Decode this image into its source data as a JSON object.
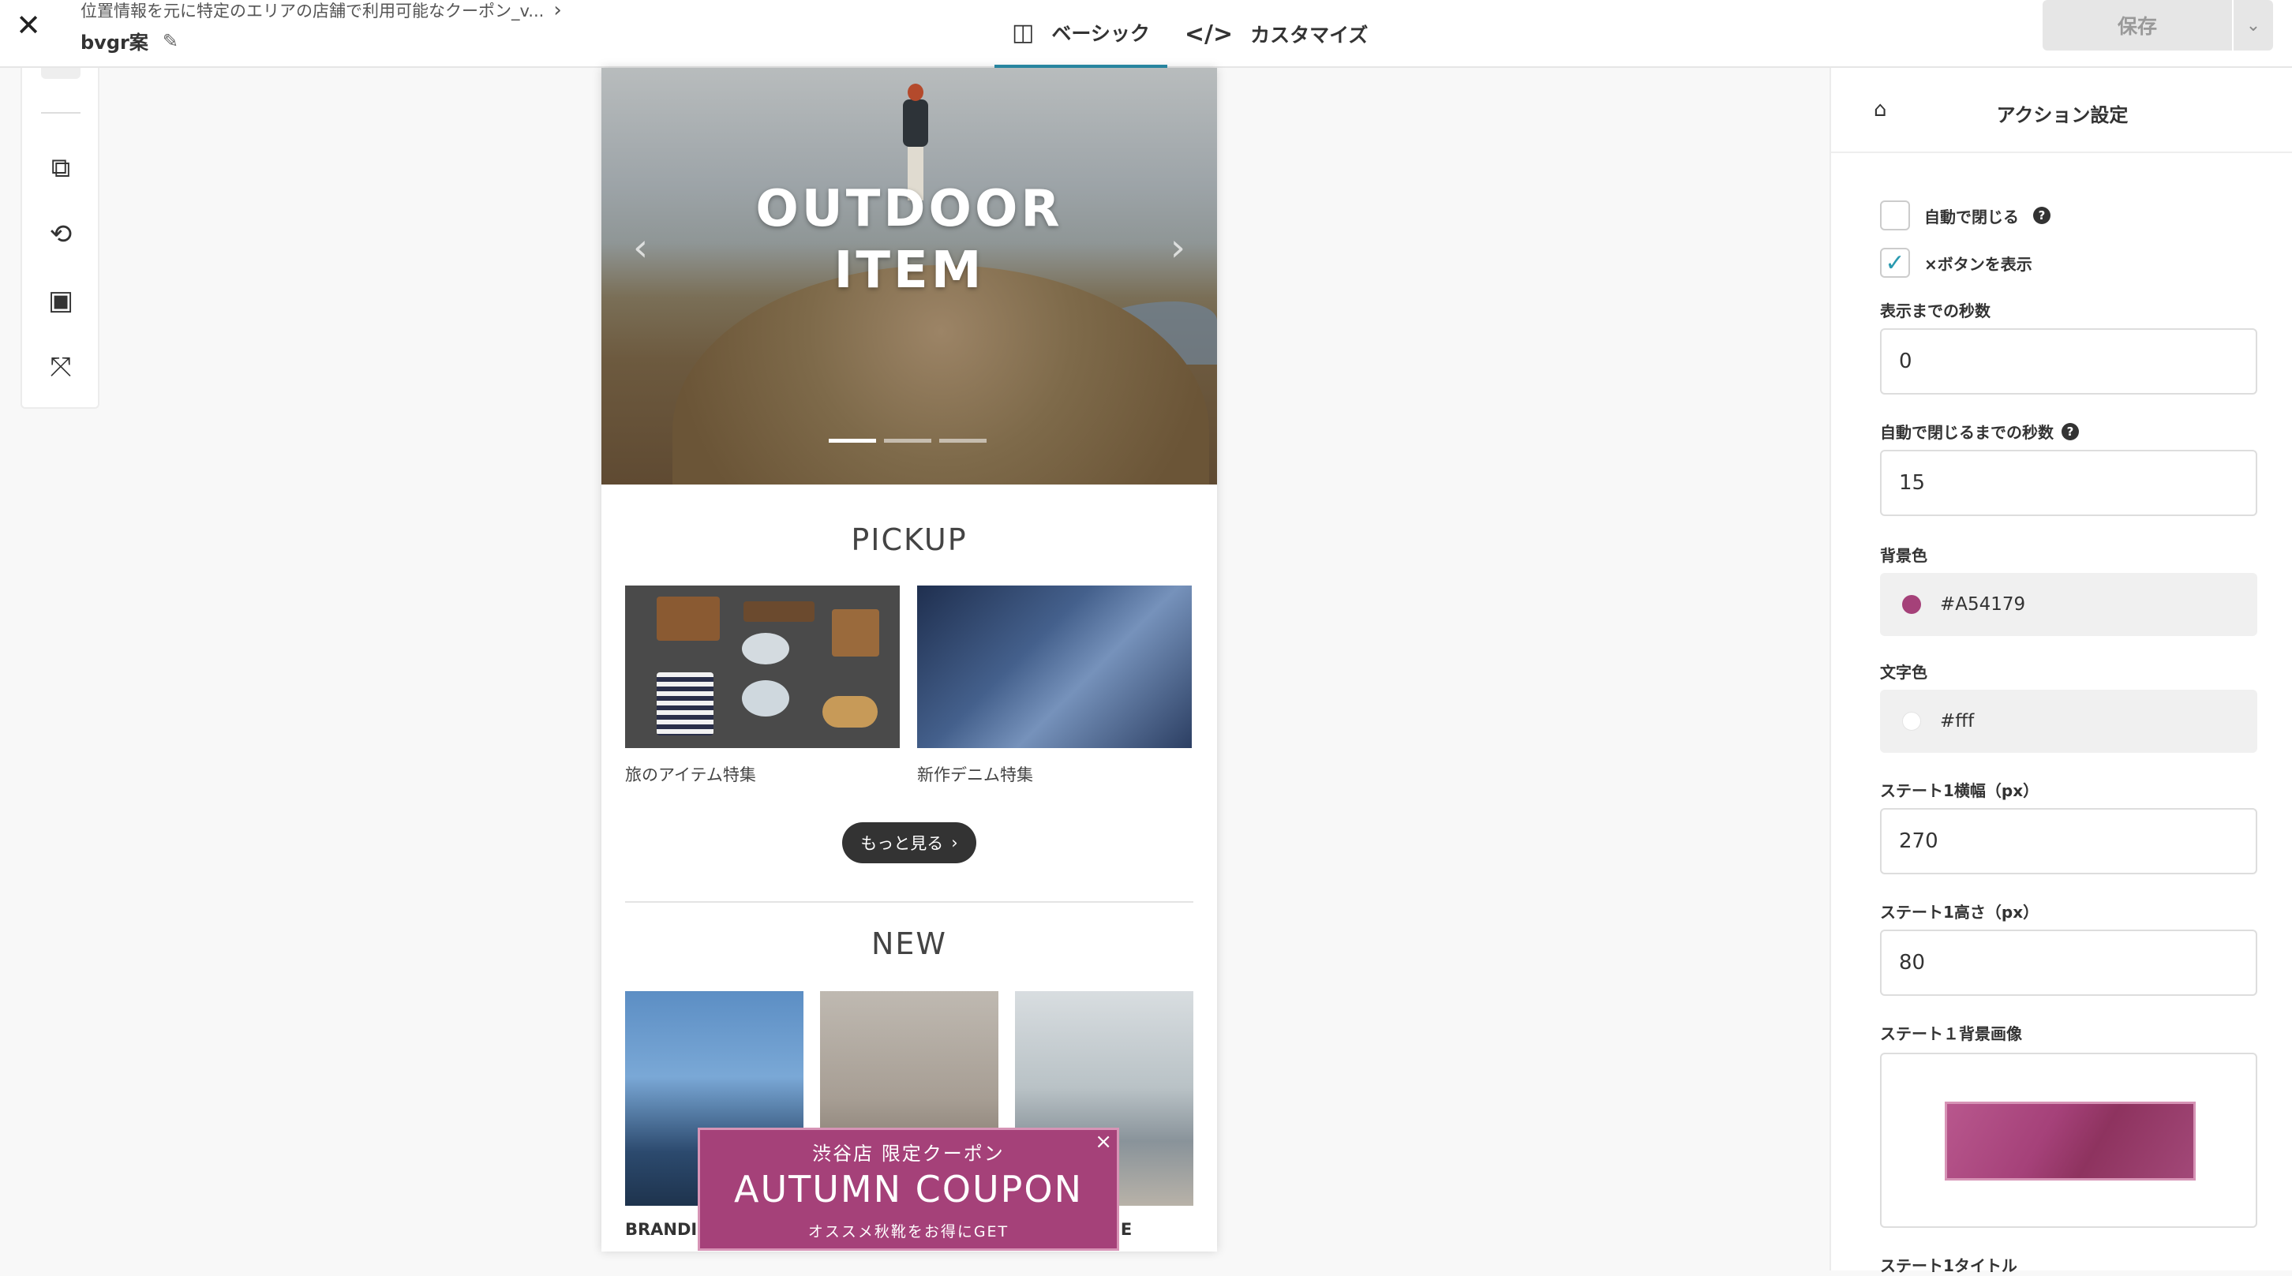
{
  "header": {
    "close_icon": "close-icon",
    "breadcrumb": "位置情報を元に特定のエリアの店舗で利用可能なクーポン_v...",
    "doc_title": "bvgr案",
    "tabs": [
      {
        "label": "ベーシック",
        "icon": "layout-icon",
        "active": true
      },
      {
        "label": "カスタマイズ",
        "icon": "code-icon",
        "active": false
      }
    ],
    "save_label": "保存"
  },
  "tools": [
    "device-icon",
    "rotate-icon",
    "play-icon",
    "fullscreen-icon"
  ],
  "preview": {
    "hero_title_line1": "OUTDOOR",
    "hero_title_line2": "ITEM",
    "pickup_title": "PICKUP",
    "pickup_items": [
      "旅のアイテム特集",
      "新作デニム特集"
    ],
    "more_label": "もっと見る",
    "new_title": "NEW",
    "new_caption_left": "BRANDI",
    "new_caption_right": "IE"
  },
  "coupon": {
    "subtitle": "渋谷店 限定クーポン",
    "title": "AUTUMN COUPON",
    "description": "オススメ秋靴をお得にGET",
    "background": "#A54179"
  },
  "settings": {
    "title": "アクション設定",
    "auto_close": {
      "label": "自動で閉じる",
      "checked": false
    },
    "show_close_button": {
      "label": "×ボタンを表示",
      "checked": true
    },
    "display_delay": {
      "label": "表示までの秒数",
      "value": "0"
    },
    "auto_close_delay": {
      "label": "自動で閉じるまでの秒数",
      "value": "15"
    },
    "bg_color": {
      "label": "背景色",
      "value": "#A54179"
    },
    "text_color": {
      "label": "文字色",
      "value": "#fff"
    },
    "state1_width": {
      "label": "ステート1横幅（px）",
      "value": "270"
    },
    "state1_height": {
      "label": "ステート1高さ（px）",
      "value": "80"
    },
    "state1_bg_image": {
      "label": "ステート１背景画像"
    },
    "state1_title": {
      "label": "ステート1タイトル"
    }
  }
}
